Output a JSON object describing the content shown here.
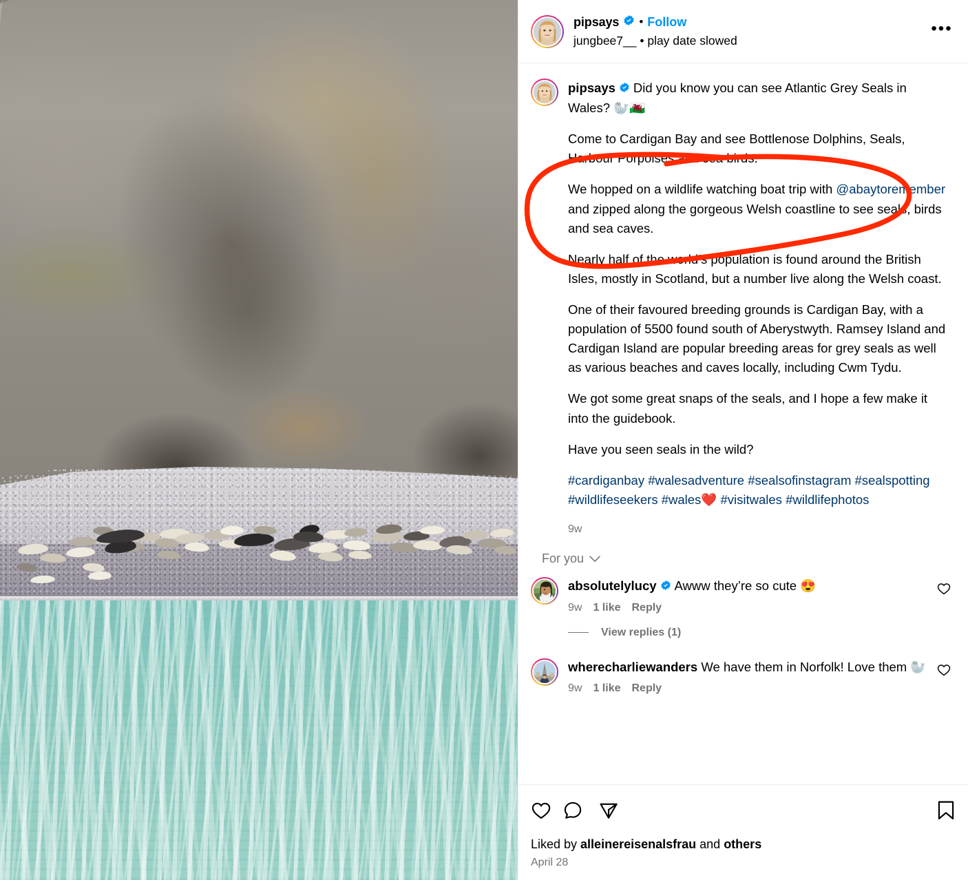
{
  "header": {
    "username": "pipsays",
    "verified": true,
    "separator": "•",
    "follow_label": "Follow",
    "audio_line": "jungbee7__  •  play date slowed",
    "more_options": "•••"
  },
  "caption": {
    "author": "pipsays",
    "author_verified": true,
    "paragraphs": [
      "Did you know you can see Atlantic Grey Seals in Wales? 🦭🏴󠁧󠁢󠁷󠁬󠁳󠁿",
      "Come to Cardigan Bay and see Bottlenose Dolphins, Seals, Harbour Porpoises and sea birds.",
      "We hopped on a wildlife watching boat trip with @abaytoremember and zipped along the gorgeous Welsh coastline to see seals, birds and sea caves.",
      "Nearly half of the world’s population is found around the British Isles, mostly in Scotland, but a number live along the Welsh coast.",
      "One of their favoured breeding grounds is Cardigan Bay, with a population of 5500 found south of Aberystwyth. Ramsey Island and Cardigan Island are popular breeding areas for grey seals as well as various beaches and caves locally, including Cwm Tydu.",
      "We got some great snaps of the seals, and I hope a few make it into the guidebook.",
      "Have you seen seals in the wild?"
    ],
    "p3_prefix": "We hopped on a wildlife watching boat trip with ",
    "p3_mention": "@abaytoremember",
    "p3_suffix": " and zipped along the gorgeous Welsh coastline to see seals, birds and sea caves.",
    "mention": "@abaytoremember",
    "hashtags": "#cardiganbay #walesadventure #sealsofinstagram #sealspotting #wildlifeseekers #wales❤️ #visitwales #wildlifephotos",
    "timestamp": "9w"
  },
  "comments_filter": {
    "label": "For you",
    "chevron": "chevron-down"
  },
  "comments": [
    {
      "username": "absolutelylucy",
      "verified": true,
      "text": "Awww they’re so cute 😍",
      "time": "9w",
      "likes": "1 like",
      "reply": "Reply",
      "view_replies": "View replies (1)"
    },
    {
      "username": "wherecharliewanders",
      "verified": false,
      "text": "We have them in Norfolk! Love them 🦭",
      "time": "9w",
      "likes": "1 like",
      "reply": "Reply"
    }
  ],
  "footer": {
    "like_icon": "heart-icon",
    "comment_icon": "comment-icon",
    "share_icon": "share-icon",
    "save_icon": "bookmark-icon",
    "liked_by_prefix": "Liked by ",
    "liked_by_user": "alleinereisenalsfrau",
    "liked_by_middle": " and ",
    "liked_by_others": "others",
    "date": "April 28"
  },
  "annotation": {
    "shape": "hand-drawn-ellipse",
    "color": "#FF2A00",
    "stroke_width": 7
  },
  "media": {
    "description": "Atlantic grey seals hauled out on a pebble beach below a rocky cliff, turquoise sea in foreground",
    "colors": {
      "cliff": "#97928a",
      "beach_upper": "#cfcdd2",
      "beach_lower": "#9b96a1",
      "sea": "#8ecac0"
    }
  },
  "theme": {
    "link_blue": "#0095f6",
    "mention_blue": "#00376b",
    "muted_grey": "#737373",
    "divider": "#efefef"
  }
}
